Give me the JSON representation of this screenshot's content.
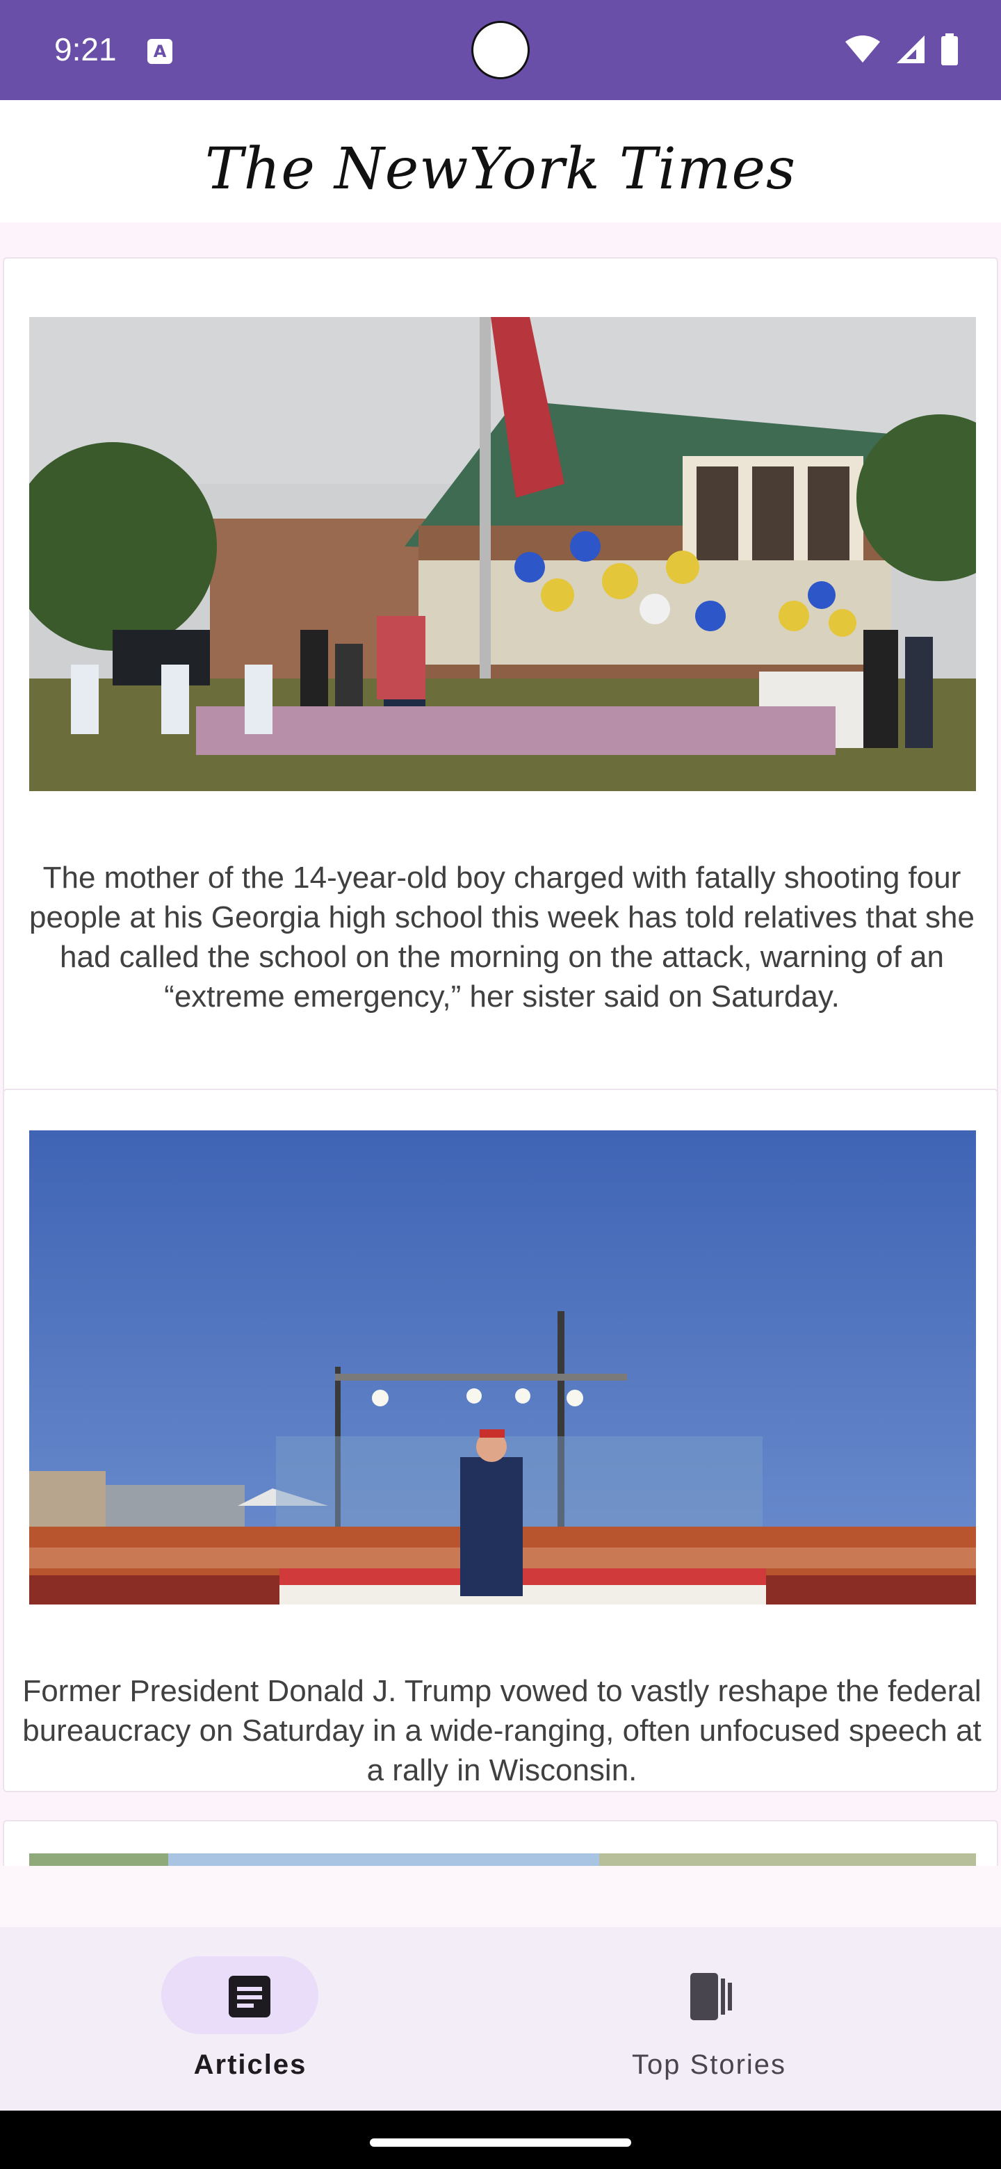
{
  "status_bar": {
    "time": "9:21",
    "app_icon_letter": "A",
    "icons": [
      "wifi-icon",
      "signal-icon",
      "battery-icon"
    ],
    "background": "#6a4fa8"
  },
  "app_bar": {
    "title": "The NewYork Times"
  },
  "articles": [
    {
      "image_icon": "memorial-photo",
      "abstract": "The mother of the 14-year-old boy charged with fatally shooting four people at his Georgia high school this week has told relatives that she had called the school on the morning on the attack, warning of an “extreme emergency,” her sister said on Saturday."
    },
    {
      "image_icon": "rally-photo",
      "abstract": "Former President Donald J. Trump vowed to vastly reshape the federal bureaucracy on Saturday in a wide-ranging, often unfocused speech at a rally in Wisconsin."
    },
    {
      "image_icon": "landscape-photo",
      "abstract": ""
    }
  ],
  "bottom_nav": {
    "items": [
      {
        "label": "Articles",
        "icon": "article-icon",
        "selected": true
      },
      {
        "label": "Top Stories",
        "icon": "stories-icon",
        "selected": false
      }
    ],
    "accent": "#e9ddf9"
  }
}
